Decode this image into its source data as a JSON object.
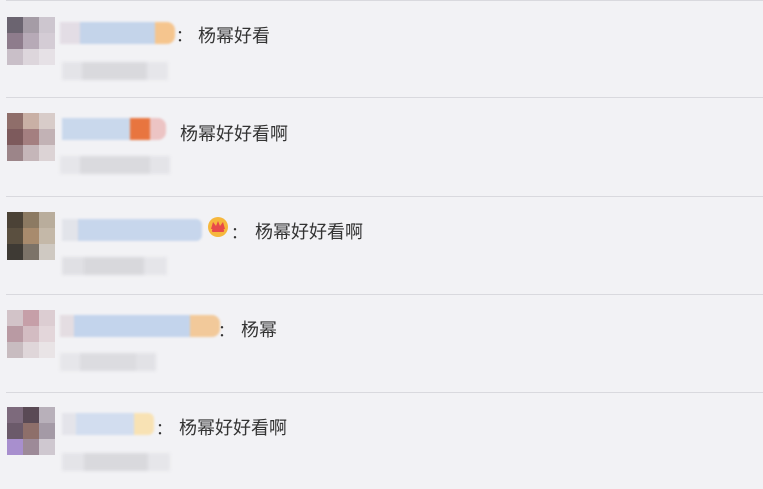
{
  "comments": [
    {
      "name": "",
      "text": "杨幂好看",
      "time": ""
    },
    {
      "name": "",
      "text": "杨幂好好看啊",
      "time": ""
    },
    {
      "name": "",
      "text": "杨幂好好看啊",
      "time": ""
    },
    {
      "name": "",
      "text": "杨幂",
      "time": ""
    },
    {
      "name": "",
      "text": "杨幂好好看啊",
      "time": ""
    }
  ],
  "separator": "：",
  "badge_icon": "crown-icon",
  "colors": {
    "background": "#f2f2f5",
    "divider": "#d9d9de",
    "text": "#333333",
    "name_blue": "#c2d3ea"
  }
}
